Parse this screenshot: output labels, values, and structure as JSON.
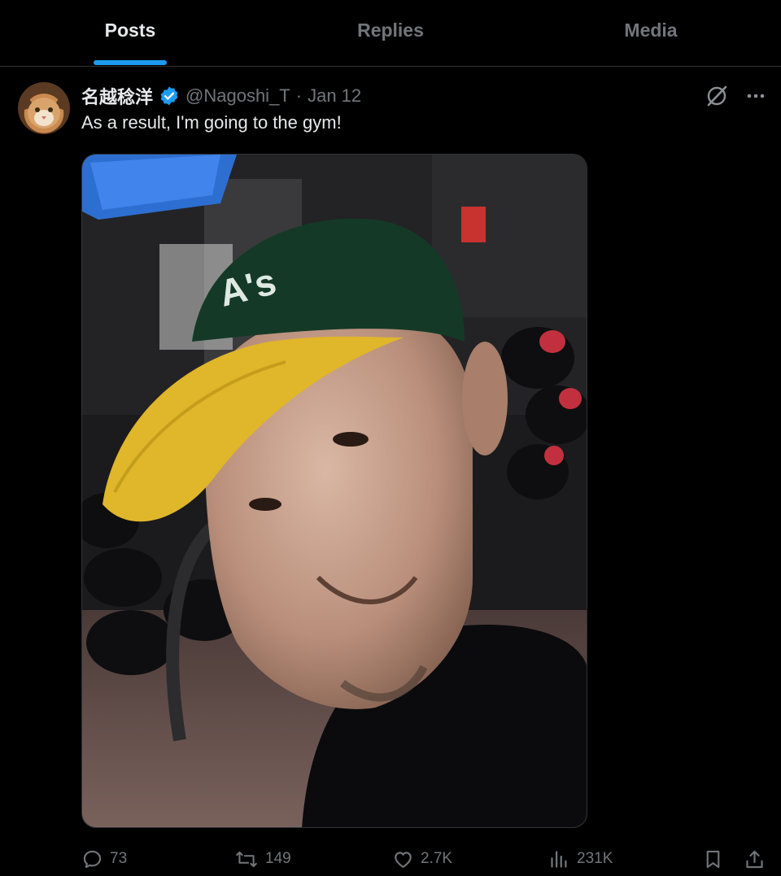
{
  "tabs": [
    {
      "label": "Posts",
      "active": true
    },
    {
      "label": "Replies",
      "active": false
    },
    {
      "label": "Media",
      "active": false
    }
  ],
  "post": {
    "display_name": "名越稔洋",
    "handle": "@Nagoshi_T",
    "separator": "·",
    "date": "Jan 12",
    "text": "As a result, I'm going to the gym!",
    "stats": {
      "replies": "73",
      "reposts": "149",
      "likes": "2.7K",
      "views": "231K"
    }
  },
  "colors": {
    "accent": "#1d9bf0",
    "background": "#000000",
    "text": "#e7e9ea",
    "muted": "#71767b",
    "border": "#2f3336"
  },
  "icons": [
    "verified-badge-icon",
    "grok-icon",
    "more-icon",
    "reply-icon",
    "repost-icon",
    "like-icon",
    "views-icon",
    "bookmark-icon",
    "share-icon"
  ]
}
